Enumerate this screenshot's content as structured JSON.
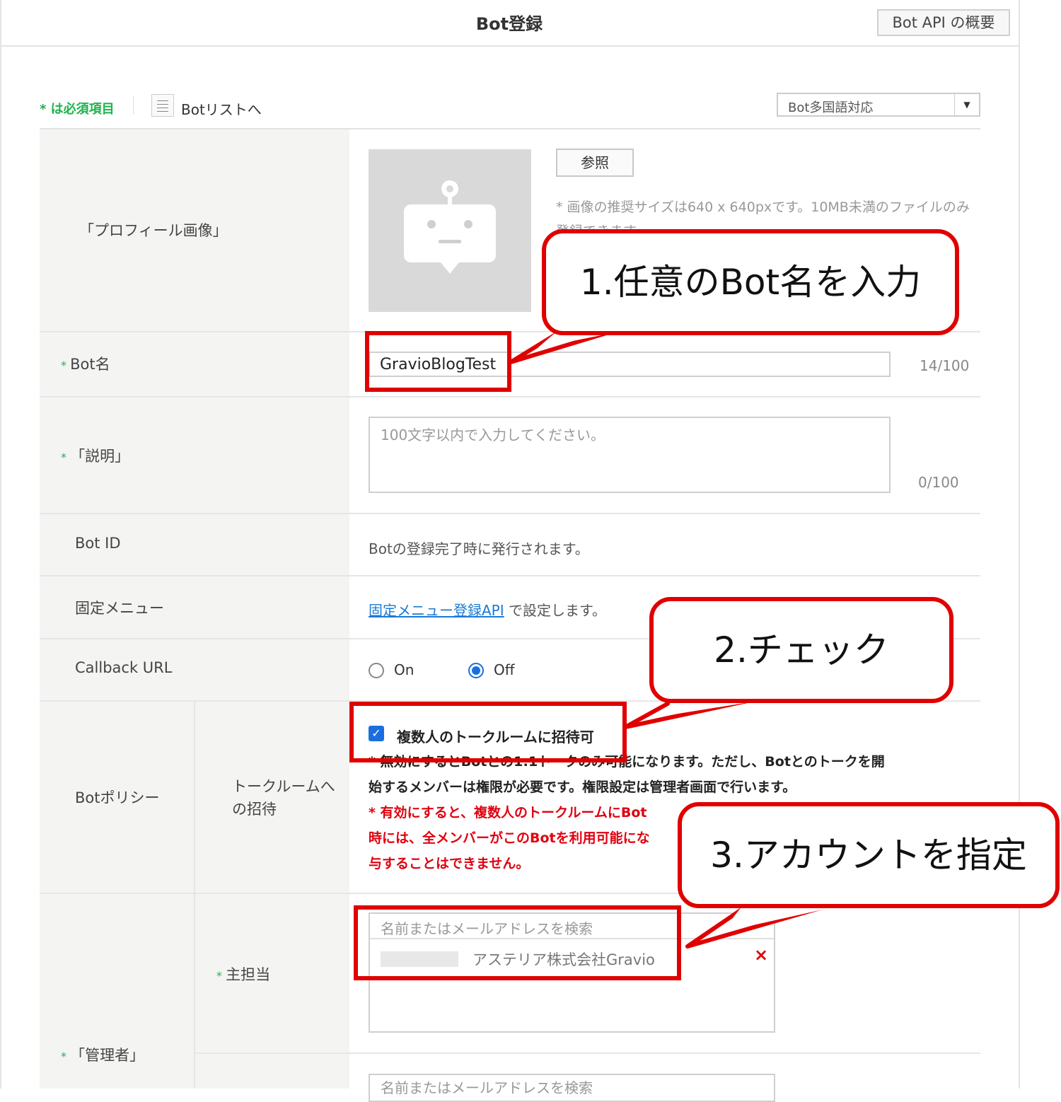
{
  "header": {
    "title": "Bot登録",
    "api_overview_button": "Bot API の概要"
  },
  "toolbar": {
    "required_note": "* は必須項目",
    "bot_list_link": "Botリストへ",
    "language_select": "Bot多国語対応"
  },
  "form": {
    "profile_image": {
      "label": "「プロフィール画像」",
      "browse_button": "参照",
      "note": "* 画像の推奨サイズは640 x 640pxです。10MB未満のファイルのみ登録できます。"
    },
    "bot_name": {
      "label": "Bot名",
      "value": "GravioBlogTest",
      "counter": "14/100"
    },
    "description": {
      "label": "「説明」",
      "placeholder": "100文字以内で入力してください。",
      "counter": "0/100"
    },
    "bot_id": {
      "label": "Bot ID",
      "text": "Botの登録完了時に発行されます。"
    },
    "fixed_menu": {
      "label": "固定メニュー",
      "link": "固定メニュー登録API",
      "suffix": " で設定します。"
    },
    "callback_url": {
      "label": "Callback URL",
      "option_on": "On",
      "option_off": "Off",
      "selected": "Off"
    },
    "bot_policy": {
      "label": "Botポリシー",
      "sub_label_line1": "トークルームへ",
      "sub_label_line2": "の招待",
      "checkbox_label": "複数人のトークルームに招待可",
      "checked": true,
      "note_line1": "* 無効にするとBotとの1:1トークのみ可能になります。ただし、Botとのトークを開",
      "note_line2": "始するメンバーは権限が必要です。権限設定は管理者画面で行います。",
      "warn_line1": "* 有効にすると、複数人のトークルームにBot",
      "warn_line2": "時には、全メンバーがこのBotを利用可能にな",
      "warn_line3": "与することはできません。"
    },
    "admin": {
      "label": "「管理者」",
      "primary_label": "主担当",
      "search_placeholder": "名前またはメールアドレスを検索",
      "selected_account": "アステリア株式会社Gravio",
      "remove": "×",
      "search_placeholder_2": "名前またはメールアドレスを検索"
    }
  },
  "annotations": {
    "callout_1": "1.任意のBot名を入力",
    "callout_2": "2.チェック",
    "callout_3": "3.アカウントを指定"
  },
  "colors": {
    "accent_green": "#1eb34c",
    "link_blue": "#1a7ad6",
    "annotation_red": "#e00000",
    "warning_red": "#e0000f"
  }
}
